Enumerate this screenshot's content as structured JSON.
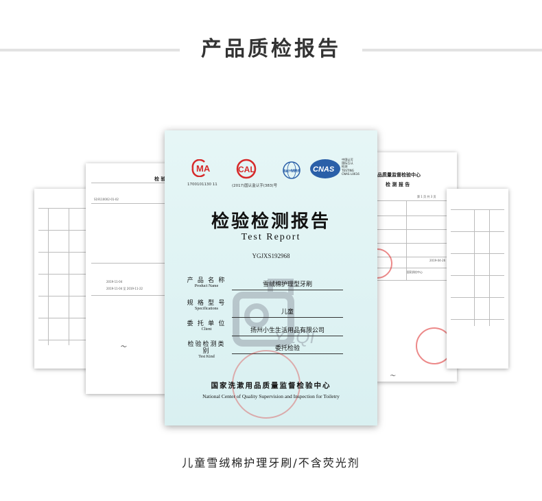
{
  "page": {
    "title": "产品质检报告",
    "caption": "儿童雪绒棉护理牙刷/不含荧光剂"
  },
  "report": {
    "logos": {
      "ma_text": "MA",
      "ma_number": "1700101130 11",
      "cal_text": "CAL",
      "cal_number": "(2017)国认监认字(383)号",
      "ilac_text": "ilac-MRA",
      "cnas_text": "CNAS",
      "cnas_caption": [
        "中国认可",
        "国际互认",
        "检测",
        "TESTING",
        "CNAS L0616"
      ]
    },
    "title": "检验检测报告",
    "subtitle": "Test    Report",
    "report_no": "YGJXS192968",
    "fields": [
      {
        "label_cn": "产 品 名 称",
        "label_en": "Product Name",
        "value": "雪绒棉护理型牙刷"
      },
      {
        "label_cn": "规 格 型 号",
        "label_en": "Specifications",
        "value": "儿童"
      },
      {
        "label_cn": "委 托 单 位",
        "label_en": "Client",
        "value": "扬州小生生活用品有限公司"
      },
      {
        "label_cn": "检验检测类别",
        "label_en": "Test Kind",
        "value": "委托检验"
      }
    ],
    "watermark": "YZQI",
    "institution_cn": "国家洗漱用品质量监督检验中心",
    "institution_en": "National Center of Quality Supervision and Inspection for Toiletry"
  },
  "side_docs": {
    "left_title": "检 验",
    "right_title_1": "品质量监督检验中心",
    "right_title_2": "检 测 报 告",
    "right_page": "第 1 页 共 3 页",
    "right_date": "2019-04-26",
    "right_center": "国家质检中心",
    "left_sample_no": "S19110002-01-02",
    "left_date": "2019-11-04",
    "left_center_note": "2019-11-04 至 2019-11-22"
  },
  "colors": {
    "accent": "#333333",
    "report_bg": "#dff3f3",
    "seal_red": "#dc2828"
  }
}
